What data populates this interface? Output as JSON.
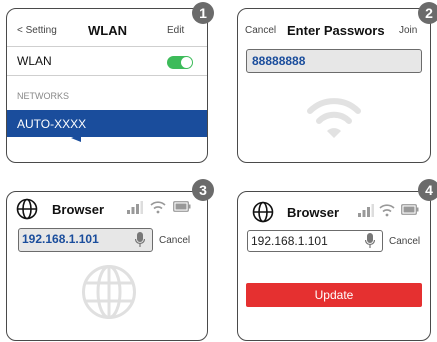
{
  "panel1": {
    "badge": "1",
    "back_label": "< Setting",
    "title": "WLAN",
    "edit_label": "Edit",
    "wlan_label": "WLAN",
    "wlan_enabled": true,
    "section_label": "NETWORKS",
    "network_name": "AUTO-XXXX"
  },
  "panel2": {
    "badge": "2",
    "cancel_label": "Cancel",
    "title": "Enter Passwors",
    "join_label": "Join",
    "password_value": "88888888",
    "icon": "wifi-icon"
  },
  "panel3": {
    "badge": "3",
    "title": "Browser",
    "url_value": "192.168.1.101",
    "cancel_label": "Cancel",
    "icons": [
      "globe-icon",
      "signal-icon",
      "wifi-icon",
      "battery-icon",
      "microphone-icon"
    ]
  },
  "panel4": {
    "badge": "4",
    "title": "Browser",
    "url_value": "192.168.1.101",
    "cancel_label": "Cancel",
    "button_label": "Update",
    "colors": {
      "button": "#e53030"
    }
  },
  "colors": {
    "selection": "#1a4d9c",
    "toggle_on": "#3dbb5a"
  }
}
